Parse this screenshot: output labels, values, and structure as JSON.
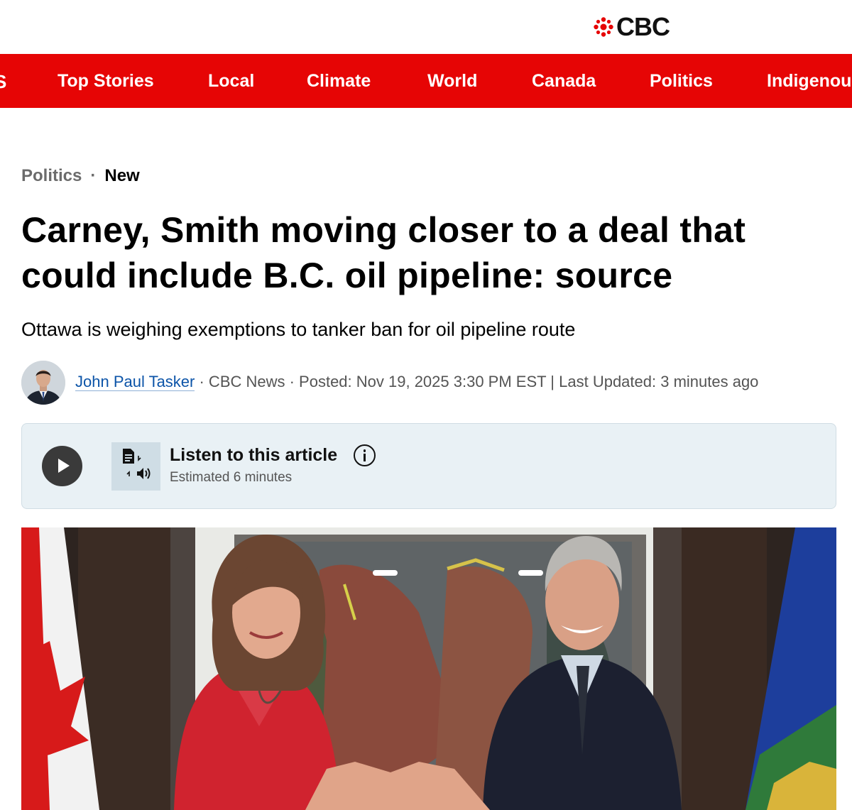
{
  "brand": {
    "logo_text": "CBC",
    "accent": "#e60505"
  },
  "nav": {
    "items": [
      {
        "label": "Top Stories"
      },
      {
        "label": "Local"
      },
      {
        "label": "Climate"
      },
      {
        "label": "World"
      },
      {
        "label": "Canada"
      },
      {
        "label": "Politics"
      },
      {
        "label": "Indigenou"
      }
    ]
  },
  "article": {
    "section": "Politics",
    "separator": "·",
    "tag": "New",
    "headline_line1": "Carney, Smith moving closer to a deal that",
    "headline_line2": "could include B.C. oil pipeline: source",
    "deck": "Ottawa is weighing exemptions to tanker ban for oil pipeline route",
    "byline": {
      "author": "John Paul Tasker",
      "meta": " · CBC News · Posted: Nov 19, 2025 3:30 PM EST | Last Updated: 3 minutes ago"
    }
  },
  "listen": {
    "title": "Listen to this article",
    "estimate": "Estimated 6 minutes"
  },
  "icons": {
    "play": "play-icon",
    "tts": "text-to-speech-icon",
    "info": "info-icon"
  }
}
